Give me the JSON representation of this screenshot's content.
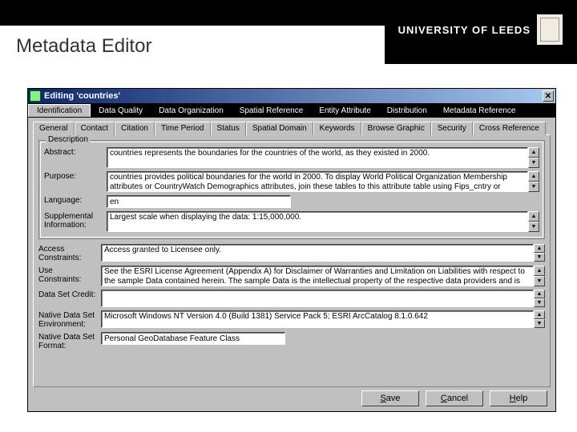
{
  "slide": {
    "title": "Metadata Editor",
    "brand": "UNIVERSITY OF LEEDS"
  },
  "win": {
    "title": "Editing 'countries'"
  },
  "nav": [
    "Identification",
    "Data Quality",
    "Data Organization",
    "Spatial Reference",
    "Entity Attribute",
    "Distribution",
    "Metadata Reference"
  ],
  "nav_active": 0,
  "tabs": [
    "General",
    "Contact",
    "Citation",
    "Time Period",
    "Status",
    "Spatial Domain",
    "Keywords",
    "Browse Graphic",
    "Security",
    "Cross Reference"
  ],
  "tab_active": 0,
  "desc_legend": "Description",
  "fields": {
    "abstract": {
      "label": "Abstract:",
      "value": "countries represents the boundaries for the countries of the world, as they existed in 2000."
    },
    "purpose": {
      "label": "Purpose:",
      "value": "countries provides political boundaries for the world in 2000. To display World Political Organization Membership attributes or CountryWatch Demographics attributes, join these tables to this attribute table using Fips_cntry or"
    },
    "language": {
      "label": "Language:",
      "value": "en"
    },
    "supp": {
      "label": "Supplemental Information:",
      "value": "Largest scale when displaying the data: 1:15,000,000."
    },
    "access": {
      "label": "Access Constraints:",
      "value": "Access granted to Licensee only."
    },
    "use": {
      "label": "Use Constraints:",
      "value": "See the ESRI License Agreement (Appendix A) for Disclaimer of Warranties and Limitation on Liabilities with respect to the sample Data contained herein. The sample Data is the intellectual property of the respective data providers and is"
    },
    "credit": {
      "label": "Data Set Credit:",
      "value": ""
    },
    "env": {
      "label": "Native Data Set Environment:",
      "value": "Microsoft Windows NT Version 4.0 (Build 1381) Service Pack 5; ESRI ArcCatalog 8.1.0.642"
    },
    "format": {
      "label": "Native Data Set Format:",
      "value": "Personal GeoDatabase Feature Class"
    }
  },
  "buttons": {
    "save": "Save",
    "cancel": "Cancel",
    "help": "Help"
  }
}
